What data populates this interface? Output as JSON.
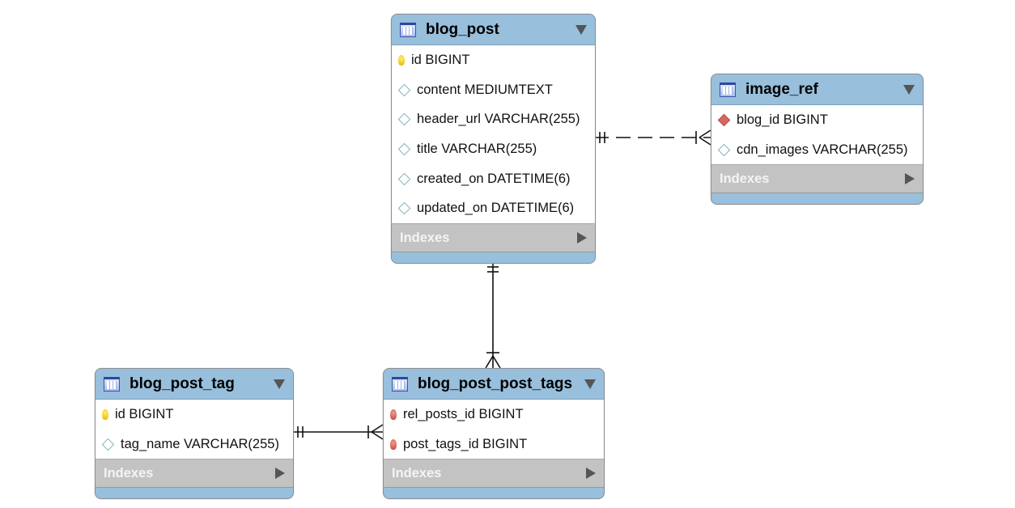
{
  "tables": [
    {
      "id": "blog_post",
      "name": "blog_post",
      "indexes_label": "Indexes",
      "columns": [
        {
          "text": "id BIGINT",
          "icon": "primary-key-icon"
        },
        {
          "text": "content MEDIUMTEXT",
          "icon": "column-icon"
        },
        {
          "text": "header_url VARCHAR(255)",
          "icon": "column-icon"
        },
        {
          "text": "title VARCHAR(255)",
          "icon": "column-icon"
        },
        {
          "text": "created_on DATETIME(6)",
          "icon": "column-icon"
        },
        {
          "text": "updated_on DATETIME(6)",
          "icon": "column-icon"
        }
      ]
    },
    {
      "id": "image_ref",
      "name": "image_ref",
      "indexes_label": "Indexes",
      "columns": [
        {
          "text": "blog_id BIGINT",
          "icon": "foreign-key-column-icon"
        },
        {
          "text": "cdn_images VARCHAR(255)",
          "icon": "column-icon"
        }
      ]
    },
    {
      "id": "blog_post_tag",
      "name": "blog_post_tag",
      "indexes_label": "Indexes",
      "columns": [
        {
          "text": "id BIGINT",
          "icon": "primary-key-icon"
        },
        {
          "text": "tag_name VARCHAR(255)",
          "icon": "column-icon"
        }
      ]
    },
    {
      "id": "blog_post_post_tags",
      "name": "blog_post_post_tags",
      "indexes_label": "Indexes",
      "columns": [
        {
          "text": "rel_posts_id BIGINT",
          "icon": "primary-foreign-key-icon"
        },
        {
          "text": "post_tags_id BIGINT",
          "icon": "primary-foreign-key-icon"
        }
      ]
    }
  ],
  "relationships": [
    {
      "from": "blog_post",
      "to": "image_ref",
      "type": "one-to-many",
      "style": "dashed"
    },
    {
      "from": "blog_post",
      "to": "blog_post_post_tags",
      "type": "one-to-many",
      "style": "solid"
    },
    {
      "from": "blog_post_tag",
      "to": "blog_post_post_tags",
      "type": "one-to-many",
      "style": "solid"
    }
  ]
}
